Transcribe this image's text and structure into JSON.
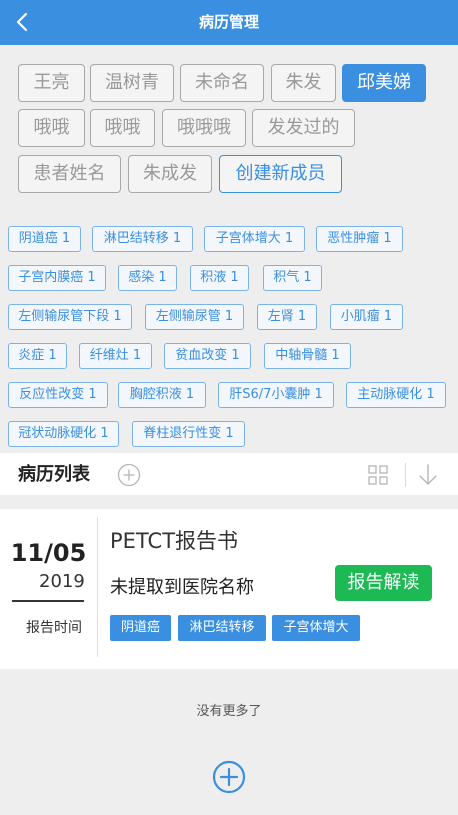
{
  "header": {
    "title": "病历管理"
  },
  "members": [
    "王亮",
    "温树青",
    "未命名",
    "朱发",
    "邱美娣",
    "哦哦",
    "哦哦",
    "哦哦哦",
    "发发过的",
    "患者姓名",
    "朱成发"
  ],
  "active_member": "邱美娣",
  "create_member_label": "创建新成员",
  "tags": [
    "阴道癌 1",
    "淋巴结转移 1",
    "子宫体增大 1",
    "恶性肿瘤 1",
    "子宫内膜癌 1",
    "感染 1",
    "积液 1",
    "积气 1",
    "左侧输尿管下段 1",
    "左侧输尿管 1",
    "左肾 1",
    "小肌瘤 1",
    "炎症 1",
    "纤维灶 1",
    "贫血改变 1",
    "中轴骨髓 1",
    "反应性改变 1",
    "胸腔积液 1",
    "肝S6/7小囊肿 1",
    "主动脉硬化 1",
    "冠状动脉硬化 1",
    "脊柱退行性变 1"
  ],
  "list": {
    "title": "病历列表"
  },
  "record": {
    "day": "11/05",
    "year": "2019",
    "date_label": "报告时间",
    "title": "PETCT报告书",
    "hospital": "未提取到医院名称",
    "action": "报告解读",
    "tags": [
      "阴道癌",
      "淋巴结转移",
      "子宫体增大"
    ]
  },
  "footer": {
    "no_more": "没有更多了"
  },
  "colors": {
    "primary": "#3a8fe0",
    "action": "#1db954"
  }
}
